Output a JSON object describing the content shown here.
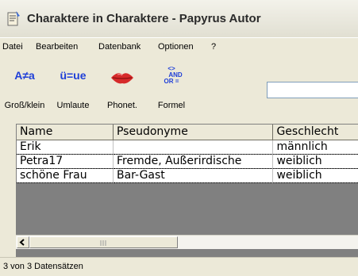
{
  "window": {
    "title": "Charaktere in Charaktere - Papyrus Autor",
    "icon": "papyrus-app-icon"
  },
  "menu": {
    "items": [
      "Datei",
      "Bearbeiten",
      "Datenbank",
      "Optionen",
      "?"
    ]
  },
  "toolbar": {
    "tools": [
      {
        "glyph": "A≠a",
        "label": "Groß/klein",
        "icon": "case-sensitive-icon"
      },
      {
        "glyph": "ü=ue",
        "label": "Umlaute",
        "icon": "umlaut-icon"
      },
      {
        "glyph": "",
        "label": "Phonet.",
        "icon": "lips-icon"
      },
      {
        "glyph_lines": [
          "<>",
          "AND",
          "OR ="
        ],
        "label": "Formel",
        "icon": "formula-icon"
      }
    ],
    "search": {
      "value": "",
      "placeholder": ""
    }
  },
  "grid": {
    "columns": [
      "Name",
      "Pseudonyme",
      "Geschlecht"
    ],
    "rows": [
      [
        "Erik",
        "",
        "männlich"
      ],
      [
        "Petra17",
        "Fremde, Außerirdische",
        "weiblich"
      ],
      [
        "schöne Frau",
        "Bar-Gast",
        "weiblich"
      ]
    ]
  },
  "scrollbar": {
    "left_arrow": "<"
  },
  "status": {
    "text": "3 von 3 Datensätzen"
  },
  "colors": {
    "accent": "#1f3fd8",
    "lips": "#d62a2a",
    "chrome": "#ece9d8"
  }
}
